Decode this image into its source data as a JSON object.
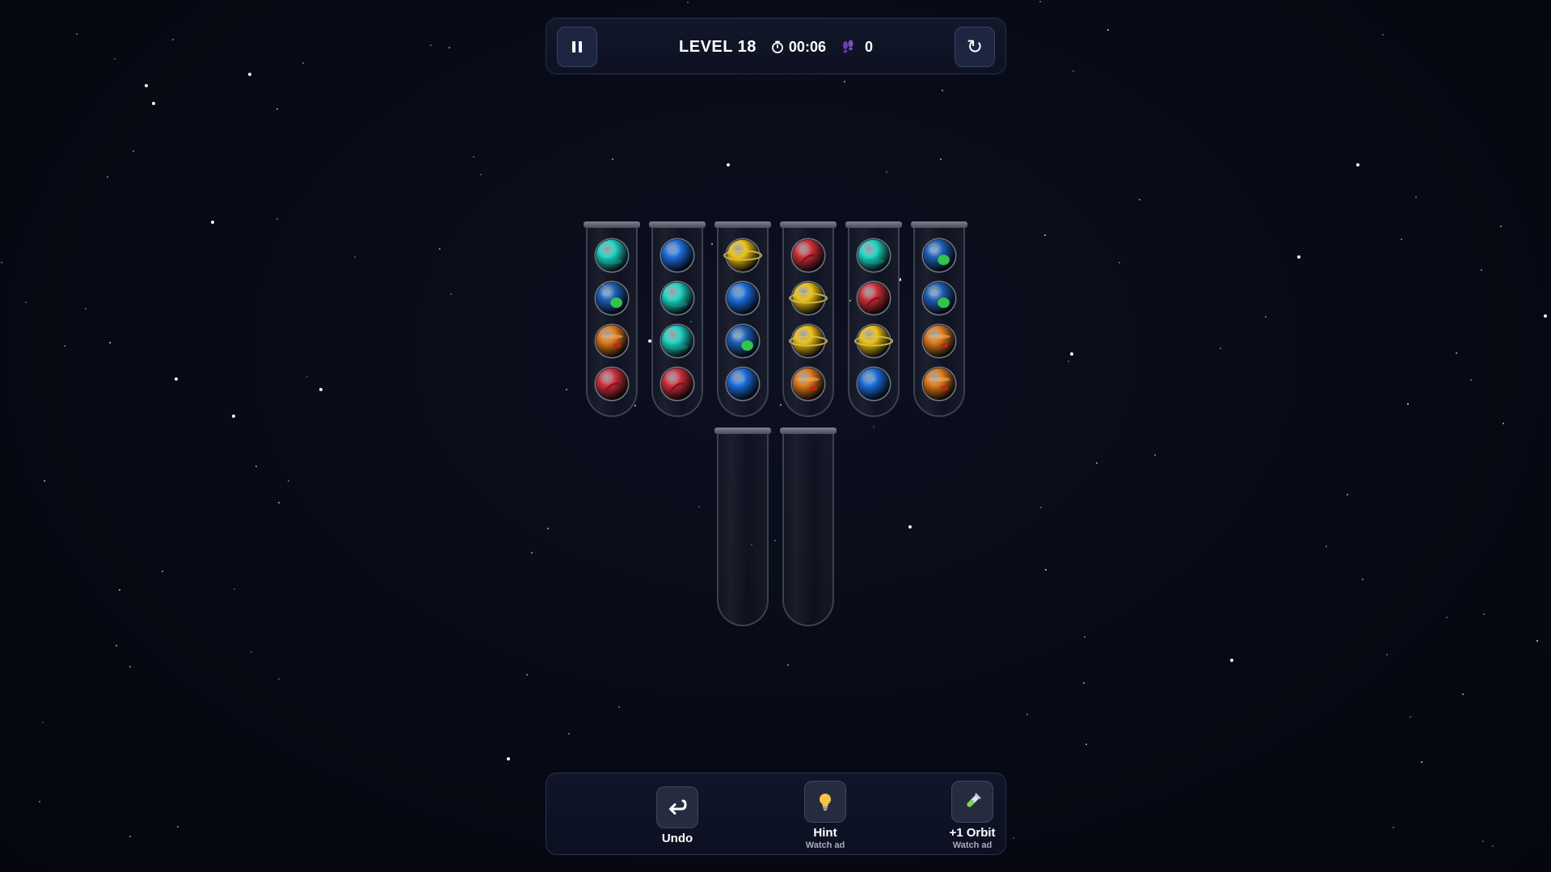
{
  "hud": {
    "level": "LEVEL 18",
    "timer": "00:06",
    "moves": "0",
    "pause_icon": "pause-icon",
    "restart_icon": "restart-icon",
    "timer_icon": "stopwatch-icon",
    "moves_icon": "footprints-icon",
    "restart_glyph": "↻"
  },
  "colors": {
    "background": "#070a14",
    "panel": "#10152a",
    "planets": {
      "cyan": "#1fd6c4",
      "blue": "#1c6fe0",
      "earth": "#1d5fb8",
      "mars": "#d0303a",
      "jupiter": "#e07a1a",
      "saturn": "#f0c214"
    }
  },
  "tubes": [
    {
      "balls": [
        "cyan",
        "earth",
        "jupiter",
        "mars"
      ]
    },
    {
      "balls": [
        "blue",
        "cyan",
        "cyan",
        "mars"
      ]
    },
    {
      "balls": [
        "saturn",
        "blue",
        "earth",
        "blue"
      ]
    },
    {
      "balls": [
        "mars",
        "saturn",
        "saturn",
        "jupiter"
      ]
    },
    {
      "balls": [
        "cyan",
        "mars",
        "saturn",
        "blue"
      ]
    },
    {
      "balls": [
        "earth",
        "earth",
        "jupiter",
        "jupiter"
      ]
    },
    {
      "balls": []
    },
    {
      "balls": []
    }
  ],
  "actions": {
    "undo": {
      "label": "Undo",
      "icon": "undo-icon"
    },
    "hint": {
      "label": "Hint",
      "sub": "Watch ad",
      "icon": "lightbulb-icon"
    },
    "orbit": {
      "label": "+1 Orbit",
      "sub": "Watch ad",
      "icon": "test-tube-icon"
    }
  }
}
